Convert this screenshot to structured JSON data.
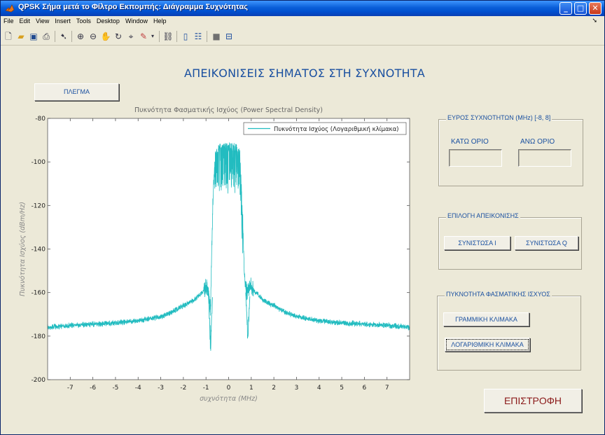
{
  "window": {
    "title": "QPSK Σήμα μετά το Φίλτρο Εκπομπής: Διάγραμμα Συχνότητας",
    "minimize_label": "_",
    "maximize_label": "□",
    "close_label": "✕"
  },
  "menu": [
    "File",
    "Edit",
    "View",
    "Insert",
    "Tools",
    "Desktop",
    "Window",
    "Help"
  ],
  "toolbar_icons": [
    "new-file-icon",
    "open-folder-icon",
    "save-icon",
    "print-icon",
    "pointer-icon",
    "zoom-in-icon",
    "zoom-out-icon",
    "pan-icon",
    "rotate-icon",
    "data-cursor-icon",
    "brush-icon",
    "link-icon",
    "colorbar-icon",
    "legend-icon",
    "hide-plot-tools-icon",
    "show-plot-tools-icon"
  ],
  "heading": "ΑΠΕΙΚΟΝΙΣΕΙΣ ΣΗΜΑΤΟΣ ΣΤΗ ΣΥΧΝΟΤΗΤΑ",
  "grid_button": "ΠΛΕΓΜΑ",
  "return_button": "ΕΠΙΣΤΡΟΦΗ",
  "freq_range": {
    "legend": "ΕΥΡΟΣ ΣΥΧΝΟΤΗΤΩΝ (MHz) [-8, 8]",
    "lower_label": "ΚΑΤΩ ΟΡΙΟ",
    "upper_label": "ΑΝΩ ΟΡΙΟ",
    "lower_value": "",
    "upper_value": ""
  },
  "display_select": {
    "legend": "ΕΠΙΛΟΓΗ ΑΠΕΙΚΟΝΙΣΗΣ",
    "i_button": "ΣΥΝΙΣΤΩΣΑ I",
    "q_button": "ΣΥΝΙΣΤΩΣΑ Q"
  },
  "psd_scale": {
    "legend": "ΠΥΚΝΟΤΗΤΑ ΦΑΣΜΑΤΙΚΗΣ ΙΣΧΥΟΣ",
    "linear_button": "ΓΡΑΜΜΙΚΗ ΚΛΙΜΑΚΑ",
    "log_button": "ΛΟΓΑΡΙΘΜΙΚΗ ΚΛΙΜΑΚΑ"
  },
  "colors": {
    "trace": "#22bcc0",
    "accent_text": "#1a50a0",
    "return_text": "#8b1a1a"
  },
  "chart_data": {
    "type": "line",
    "title": "Πυκνότητα Φασματικής Ισχύος (Power Spectral Density)",
    "xlabel": "συχνότητα (MHz)",
    "ylabel": "Πυκνότητα Ισχύος (dBm/Hz)",
    "xlim": [
      -8,
      8
    ],
    "ylim": [
      -200,
      -80
    ],
    "xticks": [
      -7,
      -6,
      -5,
      -4,
      -3,
      -2,
      -1,
      0,
      1,
      2,
      3,
      4,
      5,
      6,
      7
    ],
    "yticks": [
      -80,
      -100,
      -120,
      -140,
      -160,
      -180,
      -200
    ],
    "grid": false,
    "legend_position": "top-right",
    "series": [
      {
        "name": "Πυκνότητα Ισχύος (Λογαριθμική κλίμακα)",
        "x": [
          -8,
          -7,
          -6,
          -5,
          -4,
          -3,
          -2.5,
          -2,
          -1.6,
          -1.3,
          -1.1,
          -1.0,
          -0.9,
          -0.8,
          -0.7,
          -0.6,
          -0.5,
          -0.4,
          -0.2,
          0,
          0.2,
          0.4,
          0.5,
          0.6,
          0.7,
          0.8,
          0.9,
          1.0,
          1.1,
          1.3,
          1.6,
          2,
          2.5,
          3,
          4,
          5,
          6,
          7,
          8
        ],
        "y": [
          -176,
          -175,
          -174.5,
          -174,
          -173,
          -171,
          -169,
          -166,
          -164,
          -161,
          -159,
          -157,
          -160,
          -168,
          -120,
          -97,
          -94,
          -93,
          -93,
          -93,
          -93,
          -94,
          -97,
          -120,
          -152,
          -160,
          -158,
          -157,
          -159,
          -161,
          -164,
          -166,
          -169,
          -171,
          -173,
          -174,
          -174.5,
          -175,
          -176
        ]
      }
    ],
    "annotations": [
      {
        "x": -0.8,
        "y": -190,
        "text": ""
      },
      {
        "x": 0.85,
        "y": -187,
        "text": ""
      }
    ]
  }
}
